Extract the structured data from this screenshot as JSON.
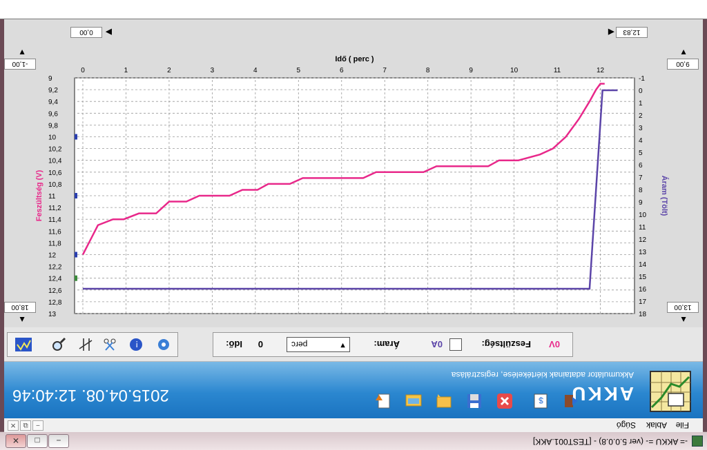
{
  "window": {
    "title": "-= AKKU =- (ver 5.0.0.8) - [TEST001.AKK]",
    "min": "−",
    "max": "□",
    "close": "✕"
  },
  "menu": {
    "items": [
      "File",
      "Ablak",
      "Súgó"
    ],
    "mdi": [
      "−",
      "⧉",
      "✕"
    ]
  },
  "banner": {
    "brand": "AKKU",
    "subtitle": "Akkumulátor adatainak kiértékelése, regisztrálása",
    "datetime": "2015.04.08. 12:40:46"
  },
  "toolbar_icons": [
    "export-icon",
    "folder-open-icon",
    "comment-icon",
    "save-icon",
    "delete-icon",
    "report-icon",
    "exit-icon"
  ],
  "controls": {
    "time_label": "Idő:",
    "time_value": "0",
    "unit_value": "perc",
    "current_label": "Áram:",
    "current_value": "0A",
    "voltage_label": "Feszültség:",
    "voltage_value": "0V",
    "icons": [
      "chart-icon",
      "magnifier-icon",
      "cut-markers-icon",
      "scissors-icon",
      "info-icon",
      "settings-icon"
    ]
  },
  "range_boxes": {
    "x_min": "0,00",
    "x_max": "12,83",
    "y_left_top": "9,00",
    "y_left_bottom": "13,00",
    "y_right_top": "-1,00",
    "y_right_bottom": "18,00"
  },
  "chart_data": {
    "type": "line",
    "xlabel": "Idő ( perc )",
    "ylabel_left": "Feszültség (V)",
    "ylabel_right": "Áram (Tölt)",
    "x_ticks": [
      "0",
      "1",
      "2",
      "3",
      "4",
      "5",
      "6",
      "7",
      "8",
      "9",
      "10",
      "11",
      "12"
    ],
    "xlim": [
      0,
      12.6
    ],
    "y_left_ticks": [
      "9",
      "9,2",
      "9,4",
      "9,6",
      "9,8",
      "10",
      "10,2",
      "10,4",
      "10,6",
      "10,8",
      "11",
      "11,2",
      "11,4",
      "11,6",
      "11,8",
      "12",
      "12,2",
      "12,4",
      "12,6",
      "12,8",
      "13"
    ],
    "y_left_lim": [
      9,
      13
    ],
    "y_right_ticks": [
      "-1",
      "0",
      "1",
      "2",
      "3",
      "4",
      "5",
      "6",
      "7",
      "8",
      "9",
      "10",
      "11",
      "12",
      "13",
      "14",
      "15",
      "16",
      "17",
      "18"
    ],
    "y_right_lim": [
      -1,
      18
    ],
    "grid": true,
    "series": [
      {
        "name": "Feszültség",
        "color": "#e8288a",
        "axis": "left",
        "x": [
          0,
          0.35,
          0.7,
          0.95,
          1.3,
          1.7,
          2.0,
          2.4,
          2.7,
          3.4,
          3.7,
          4.05,
          4.3,
          4.8,
          5.1,
          5.35,
          6.5,
          6.8,
          7.9,
          8.2,
          9.4,
          9.65,
          10.1,
          10.6,
          10.9,
          11.2,
          11.5,
          11.75,
          11.9,
          12.0,
          12.1
        ],
        "y": [
          12.0,
          11.5,
          11.4,
          11.4,
          11.3,
          11.3,
          11.1,
          11.1,
          11.0,
          11.0,
          10.9,
          10.9,
          10.8,
          10.8,
          10.7,
          10.7,
          10.7,
          10.6,
          10.6,
          10.5,
          10.5,
          10.4,
          10.4,
          10.3,
          10.2,
          10.0,
          9.7,
          9.4,
          9.2,
          9.1,
          9.1
        ]
      },
      {
        "name": "Áram",
        "color": "#5b44a8",
        "axis": "right",
        "x": [
          0,
          11.75,
          12.05,
          12.4
        ],
        "y": [
          16,
          16,
          0,
          0
        ]
      }
    ]
  }
}
